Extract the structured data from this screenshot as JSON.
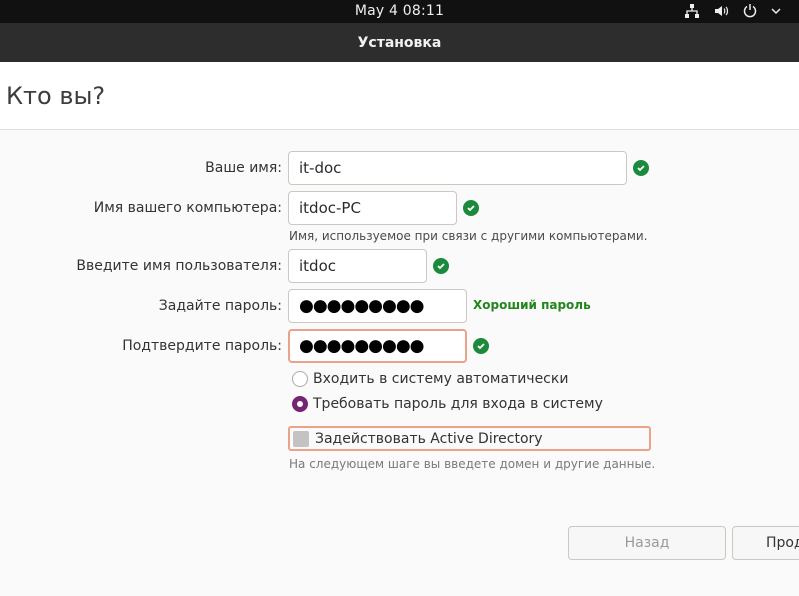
{
  "topbar": {
    "clock": "May 4  08:11"
  },
  "window": {
    "title": "Установка"
  },
  "page": {
    "title": "Кто вы?"
  },
  "form": {
    "name": {
      "label": "Ваше имя:",
      "value": "it-doc"
    },
    "computer": {
      "label": "Имя вашего компьютера:",
      "value": "itdoc-PC",
      "hint": "Имя, используемое при связи с другими компьютерами."
    },
    "username": {
      "label": "Введите имя пользователя:",
      "value": "itdoc"
    },
    "password": {
      "label": "Задайте пароль:",
      "value": "●●●●●●●●●",
      "strength": "Хороший пароль"
    },
    "confirm": {
      "label": "Подтвердите пароль:",
      "value": "●●●●●●●●●"
    },
    "login_options": {
      "auto": "Входить в систему автоматически",
      "require": "Требовать пароль для входа в систему",
      "selected": "require"
    },
    "active_directory": {
      "label": "Задействовать Active Directory",
      "checked": false,
      "hint": "На следующем шаге вы введете домен и другие данные."
    }
  },
  "buttons": {
    "back": "Назад",
    "next": "Прод"
  },
  "colors": {
    "valid": "#1c8a3c",
    "accent": "#762572",
    "focus": "#e9a38a"
  }
}
